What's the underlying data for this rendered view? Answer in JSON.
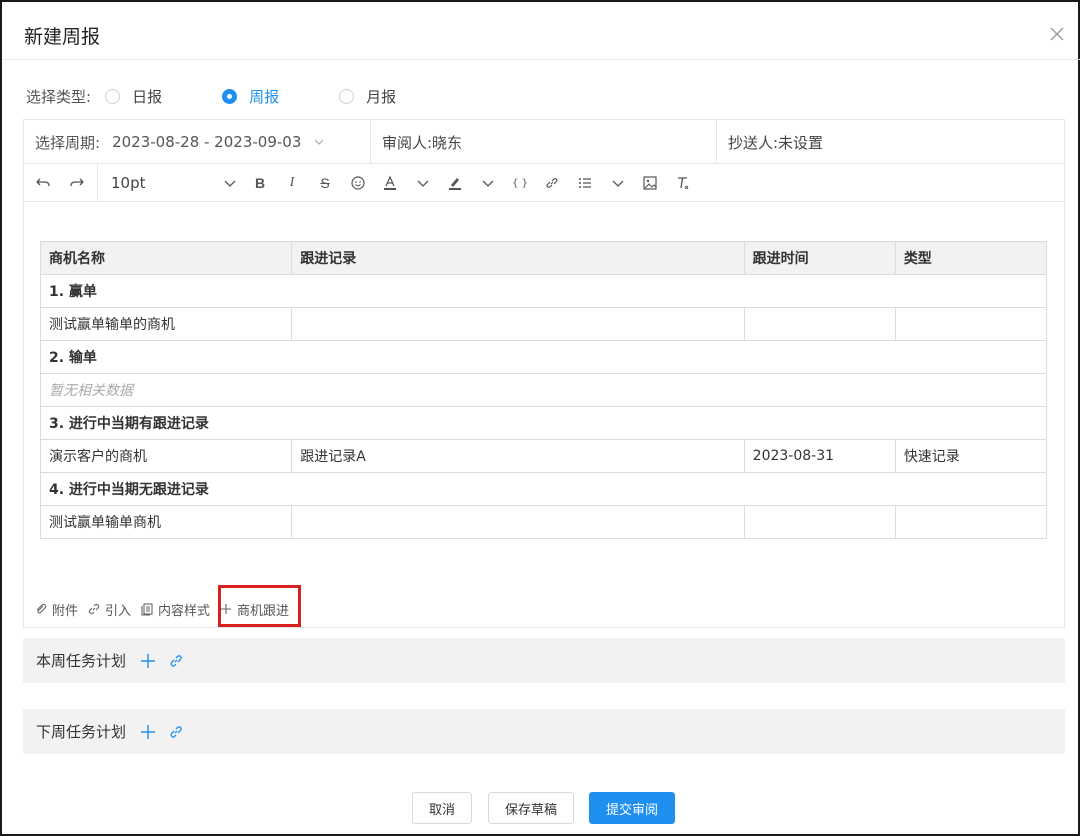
{
  "dialog": {
    "title": "新建周报"
  },
  "report_type": {
    "label": "选择类型:",
    "options": [
      {
        "label": "日报",
        "selected": false
      },
      {
        "label": "周报",
        "selected": true
      },
      {
        "label": "月报",
        "selected": false
      }
    ]
  },
  "meta": {
    "period_label": "选择周期:",
    "period_value": "2023-08-28 - 2023-09-03",
    "reviewer": "审阅人:晓东",
    "cc": "抄送人:未设置"
  },
  "toolbar": {
    "font_size": "10pt"
  },
  "table": {
    "headers": [
      "商机名称",
      "跟进记录",
      "跟进时间",
      "类型"
    ],
    "sections": [
      {
        "title": "1. 赢单",
        "rows": [
          [
            "测试赢单输单的商机",
            "",
            "",
            ""
          ]
        ]
      },
      {
        "title": "2. 输单",
        "empty": "暂无相关数据",
        "rows": []
      },
      {
        "title": "3. 进行中当期有跟进记录",
        "rows": [
          [
            "演示客户的商机",
            "跟进记录A",
            "2023-08-31",
            "快速记录"
          ]
        ]
      },
      {
        "title": "4. 进行中当期无跟进记录",
        "rows": [
          [
            "测试赢单输单商机",
            "",
            "",
            ""
          ]
        ]
      }
    ]
  },
  "attach": {
    "attachment": "附件",
    "cite": "引入",
    "template": "内容样式",
    "opportunity": "商机跟进"
  },
  "plans": {
    "this_week": "本周任务计划",
    "next_week": "下周任务计划"
  },
  "footer": {
    "cancel": "取消",
    "draft": "保存草稿",
    "submit": "提交审阅"
  },
  "colors": {
    "accent": "#1f8ff0",
    "highlight": "#d9201f"
  }
}
